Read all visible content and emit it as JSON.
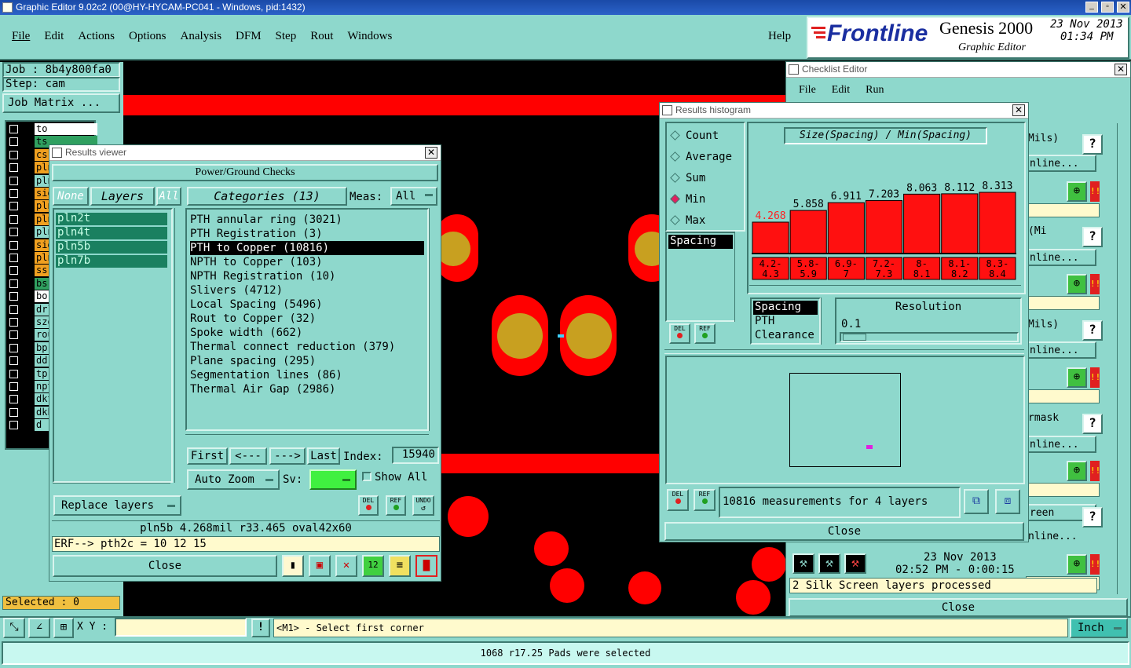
{
  "titlebar": {
    "text": "Graphic Editor 9.02c2 (00@HY-HYCAM-PC041 - Windows, pid:1432)"
  },
  "menu": [
    "File",
    "Edit",
    "Actions",
    "Options",
    "Analysis",
    "DFM",
    "Step",
    "Rout",
    "Windows"
  ],
  "help": "Help",
  "brand": {
    "logo": "Frontline",
    "product": "Genesis 2000",
    "sub": "Graphic Editor",
    "date": "23 Nov 2013",
    "time": "01:34 PM"
  },
  "job": {
    "job": "Job : 8b4y800fa0",
    "step": "Step: cam",
    "matrix": "Job Matrix ..."
  },
  "layers": [
    {
      "name": "to",
      "style": "white"
    },
    {
      "name": "ts",
      "style": "green"
    },
    {
      "name": "cs",
      "style": "orange"
    },
    {
      "name": "pln",
      "style": "orange"
    },
    {
      "name": "pln",
      "style": "teal"
    },
    {
      "name": "sig",
      "style": "orange"
    },
    {
      "name": "pln",
      "style": "orange"
    },
    {
      "name": "pln",
      "style": "orange"
    },
    {
      "name": "pln",
      "style": "teal"
    },
    {
      "name": "sig",
      "style": "orange"
    },
    {
      "name": "pln",
      "style": "orange"
    },
    {
      "name": "ss",
      "style": "orange"
    },
    {
      "name": "bs",
      "style": "green"
    },
    {
      "name": "bo",
      "style": "white"
    },
    {
      "name": "drl",
      "style": "teal"
    },
    {
      "name": "szo",
      "style": "teal"
    },
    {
      "name": "rou",
      "style": "teal"
    },
    {
      "name": "bp",
      "style": "teal"
    },
    {
      "name": "dd",
      "style": "teal"
    },
    {
      "name": "tp",
      "style": "teal"
    },
    {
      "name": "npt",
      "style": "teal"
    },
    {
      "name": "dkt",
      "style": "teal"
    },
    {
      "name": "dkb",
      "style": "teal"
    },
    {
      "name": "d",
      "style": "teal"
    }
  ],
  "selected": "Selected : 0",
  "results_viewer": {
    "title": "Results viewer",
    "header": "Power/Ground Checks",
    "none": "None",
    "layers_btn": "Layers",
    "all": "All",
    "categories_btn": "Categories (13)",
    "meas_label": "Meas:",
    "meas_value": "All",
    "layer_list": [
      "pln2t",
      "pln4t",
      "pln5b",
      "pln7b"
    ],
    "categories": [
      "PTH annular ring (3021)",
      "PTH Registration (3)",
      "PTH to Copper (10816)",
      "NPTH to Copper (103)",
      "NPTH Registration (10)",
      "Slivers (4712)",
      "Local Spacing (5496)",
      "Rout to Copper (32)",
      "Spoke width (662)",
      "Thermal connect reduction (379)",
      "Plane spacing (295)",
      "Segmentation lines (86)",
      "Thermal Air Gap (2986)"
    ],
    "selected_category": "PTH to Copper (10816)",
    "first": "First",
    "prev": "<---",
    "next": "--->",
    "last": "Last",
    "index_label": "Index:",
    "index_value": "15940",
    "autozoom": "Auto Zoom",
    "sv": "Sv:",
    "showall": "Show All",
    "del": "DEL",
    "ref": "REF",
    "undo": "UNDO",
    "replace": "Replace layers",
    "info": "pln5b 4.268mil r33.465 oval42x60",
    "erf": "ERF--> pth2c = 10 12 15",
    "close": "Close"
  },
  "histogram": {
    "title": "Results histogram",
    "modes": [
      "Count",
      "Average",
      "Sum",
      "Min",
      "Max"
    ],
    "selected_mode": "Min",
    "chart_title": "Size(Spacing) / Min(Spacing)",
    "bar_values": [
      "4.268",
      "5.858",
      "6.911",
      "7.203",
      "8.063",
      "8.112",
      "8.313"
    ],
    "bar_labels": [
      [
        "4.2-",
        "4.3"
      ],
      [
        "5.8-",
        "5.9"
      ],
      [
        "6.9-",
        "7"
      ],
      [
        "7.2-",
        "7.3"
      ],
      [
        "8-",
        "8.1"
      ],
      [
        "8.1-",
        "8.2"
      ],
      [
        "8.3-",
        "8.4"
      ]
    ],
    "list1": [
      "Spacing"
    ],
    "list2": [
      "Spacing",
      "PTH",
      "Clearance"
    ],
    "resolution_label": "Resolution",
    "resolution_value": "0.1",
    "measurements": "10816 measurements for 4 layers",
    "del": "DEL",
    "ref": "REF",
    "close": "Close"
  },
  "checklist": {
    "title": "Checklist Editor",
    "menu": [
      "File",
      "Edit",
      "Run"
    ],
    "rows": [
      "Mils)",
      "nline...",
      "(Mi",
      "nline...",
      "Mils)",
      "nline...",
      "rmask",
      "nline...",
      "d",
      "reen",
      "nline..."
    ],
    "date": "23 Nov 2013",
    "time": "02:52 PM - 0:00:15",
    "status": "2 Silk Screen layers processed",
    "close": "Close"
  },
  "bottom": {
    "xy": "X Y :",
    "prompt": "<M1> - Select first corner",
    "unit": "Inch",
    "status": "1068 r17.25 Pads were selected"
  },
  "chart_data": {
    "type": "bar",
    "title": "Size(Spacing) / Min(Spacing)",
    "categories": [
      "4.2-4.3",
      "5.8-5.9",
      "6.9-7",
      "7.2-7.3",
      "8-8.1",
      "8.1-8.2",
      "8.3-8.4"
    ],
    "values": [
      4.268,
      5.858,
      6.911,
      7.203,
      8.063,
      8.112,
      8.313
    ],
    "ylim": [
      0,
      8.313
    ]
  }
}
